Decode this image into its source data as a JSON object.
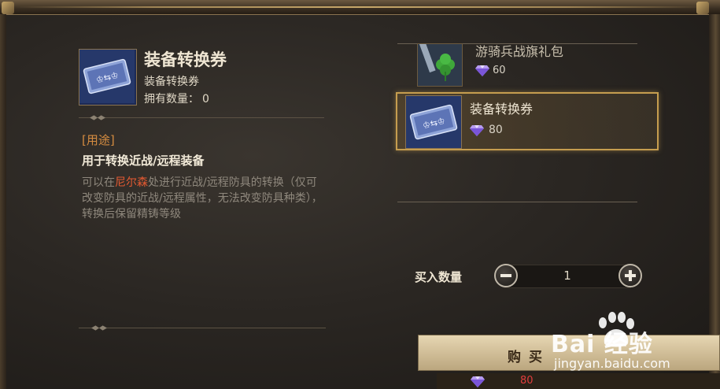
{
  "detail": {
    "title": "装备转换券",
    "subtitle": "装备转换券",
    "owned_label": "拥有数量：",
    "owned_count": "0",
    "usage_label": "[用途]",
    "usage_head": "用于转换近战/远程装备",
    "desc_part1": "可以在",
    "desc_highlight": "尼尔森",
    "desc_part2": "处进行近战/远程防具的转换（仅可改变防具的近战/远程属性，无法改变防具种类），转换后保留精铸等级"
  },
  "shop": {
    "items": [
      {
        "name": "游骑兵战旗礼包",
        "price": "60",
        "icon": "flag-clover-icon"
      },
      {
        "name": "装备转换券",
        "price": "80",
        "icon": "ticket-icon",
        "selected": true
      }
    ]
  },
  "purchase": {
    "qty_label": "买入数量",
    "qty_value": "1",
    "buy_label": "购买",
    "total_cost": "80"
  },
  "watermark": {
    "logo": "Bai  经验",
    "url": "jingyan.baidu.com"
  },
  "colors": {
    "highlight_red": "#e45a32",
    "usage_orange": "#d58c40",
    "gold_border": "#c59d4f",
    "cost_red": "#e23d3d"
  }
}
